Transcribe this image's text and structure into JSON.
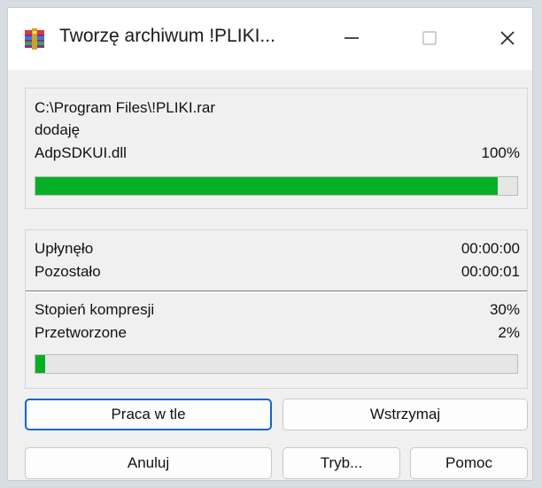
{
  "window": {
    "title": "Tworzę archiwum !PLIKI..."
  },
  "progress_section": {
    "archive_path": "C:\\Program Files\\!PLIKI.rar",
    "action": "dodaję",
    "current_file": "AdpSDKUI.dll",
    "file_percent_label": "100%",
    "file_progress": 0.96
  },
  "stats": {
    "elapsed_label": "Upłynęło",
    "elapsed_value": "00:00:00",
    "remaining_label": "Pozostało",
    "remaining_value": "00:00:01",
    "compression_label": "Stopień kompresji",
    "compression_value": "30%",
    "processed_label": "Przetworzone",
    "processed_value": "2%",
    "total_progress": 0.02
  },
  "buttons": {
    "background": "Praca w tle",
    "pause": "Wstrzymaj",
    "cancel": "Anuluj",
    "mode": "Tryb...",
    "help": "Pomoc"
  },
  "colors": {
    "progress_fill": "#06b025",
    "default_button_border": "#1567c6"
  }
}
